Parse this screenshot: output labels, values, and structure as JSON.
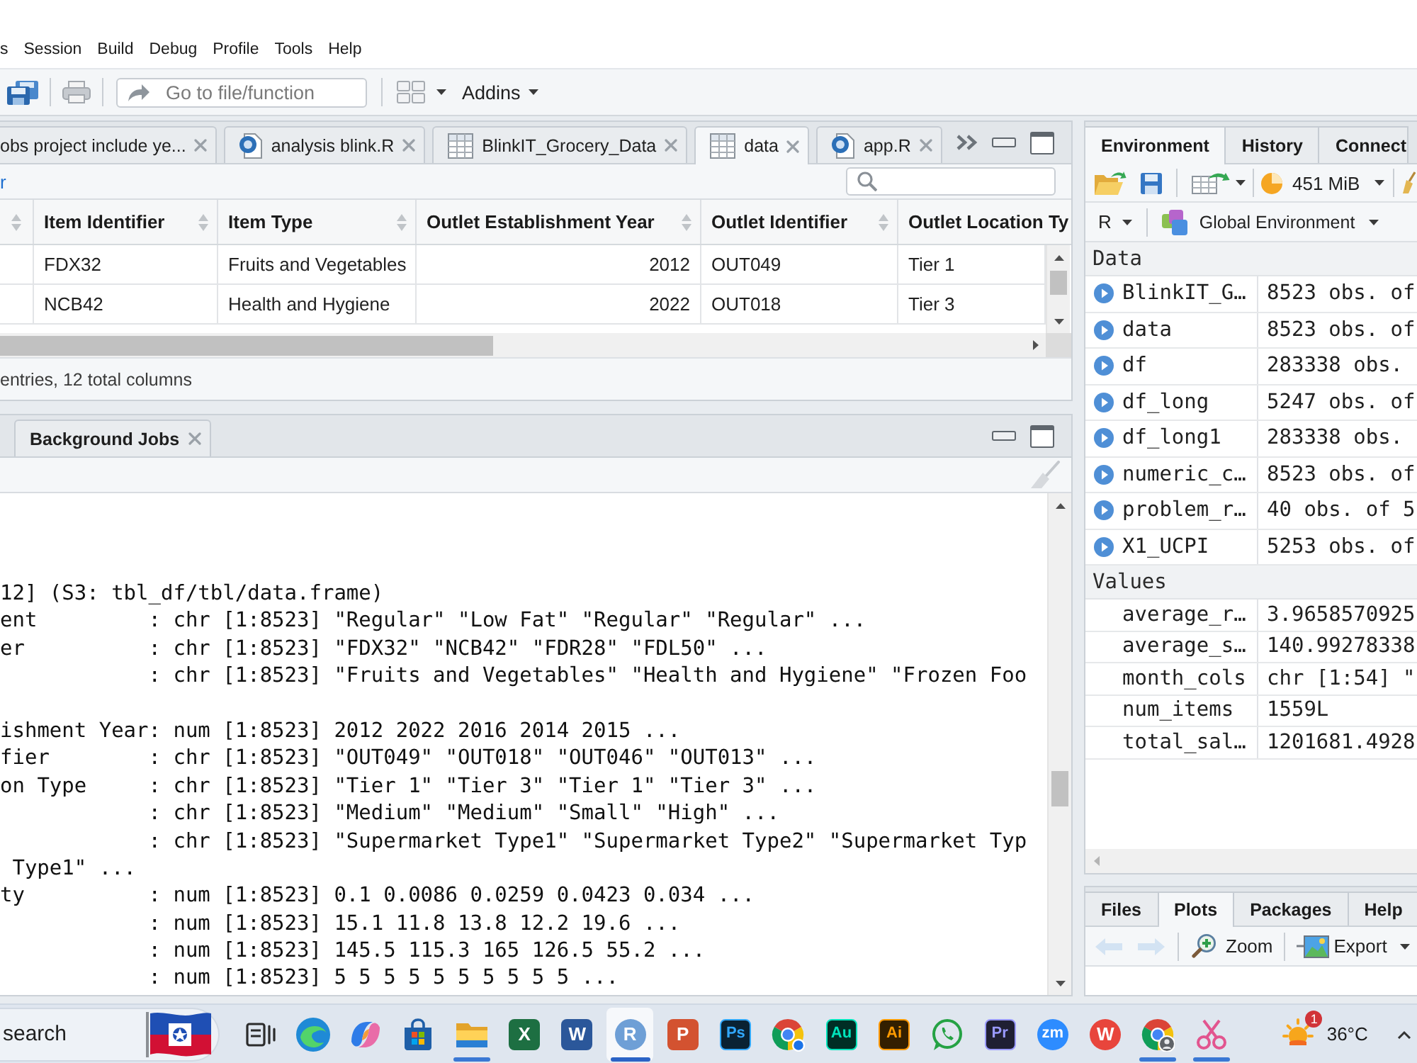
{
  "menu_bar": {
    "items": [
      "s",
      "Session",
      "Build",
      "Debug",
      "Profile",
      "Tools",
      "Help"
    ]
  },
  "toolbar": {
    "go_to_field": {
      "placeholder": "Go to file/function"
    },
    "addins_menu": "Addins"
  },
  "source_pane": {
    "tabs": [
      {
        "kind": "plain",
        "label": "obs project include ye...",
        "selected": false
      },
      {
        "kind": "script",
        "label": "analysis blink.R",
        "selected": false
      },
      {
        "kind": "viewer",
        "label": "BlinkIT_Grocery_Data",
        "selected": false
      },
      {
        "kind": "viewer",
        "label": "data",
        "selected": true
      },
      {
        "kind": "script",
        "label": "app.R",
        "selected": false
      }
    ],
    "link": "r",
    "table": {
      "columns": [
        {
          "sortable": true,
          "right_aligned": false
        },
        {
          "label": "Item Identifier",
          "right_aligned": false,
          "sortable": true
        },
        {
          "label": "Item Type",
          "right_aligned": false,
          "sortable": true
        },
        {
          "label": "Outlet Establishment Year",
          "right_aligned": true,
          "sortable": true
        },
        {
          "label": "Outlet Identifier",
          "right_aligned": false,
          "sortable": true
        },
        {
          "label": "Outlet Location Ty",
          "right_aligned": false,
          "sortable": false
        }
      ],
      "rows": [
        {
          "cells": [
            "",
            "FDX32",
            "Fruits and Vegetables",
            "2012",
            "OUT049",
            "Tier 1"
          ]
        },
        {
          "cells": [
            "",
            "NCB42",
            "Health and Hygiene",
            "2022",
            "OUT018",
            "Tier 3"
          ]
        }
      ]
    },
    "footer": "entries, 12 total columns"
  },
  "console_pane": {
    "tabs": [
      {
        "label": "Background Jobs",
        "selected": false
      }
    ],
    "lines": [
      {
        "kind": "plain",
        "text": "12] (S3: tbl_df/tbl/data.frame)"
      },
      {
        "kind": "field",
        "field": "ent",
        "value": ": chr [1:8523] \"Regular\" \"Low Fat\" \"Regular\" \"Regular\" ..."
      },
      {
        "kind": "field",
        "field": "er",
        "value": ": chr [1:8523] \"FDX32\" \"NCB42\" \"FDR28\" \"FDL50\" ..."
      },
      {
        "kind": "field",
        "value": ": chr [1:8523] \"Fruits and Vegetables\" \"Health and Hygiene\" \"Frozen Foo"
      },
      {
        "kind": "blank"
      },
      {
        "kind": "field",
        "field": "ishment Year",
        "value": ": num [1:8523] 2012 2022 2016 2014 2015 ..."
      },
      {
        "kind": "field",
        "field": "fier",
        "value": ": chr [1:8523] \"OUT049\" \"OUT018\" \"OUT046\" \"OUT013\" ..."
      },
      {
        "kind": "field",
        "field": "on Type",
        "value": ": chr [1:8523] \"Tier 1\" \"Tier 3\" \"Tier 1\" \"Tier 3\" ..."
      },
      {
        "kind": "field",
        "value": ": chr [1:8523] \"Medium\" \"Medium\" \"Small\" \"High\" ..."
      },
      {
        "kind": "field",
        "value": ": chr [1:8523] \"Supermarket Type1\" \"Supermarket Type2\" \"Supermarket Typ"
      },
      {
        "kind": "wrap",
        "text": "Type1\" ..."
      },
      {
        "kind": "field",
        "field": "ty",
        "value": ": num [1:8523] 0.1 0.0086 0.0259 0.0423 0.034 ..."
      },
      {
        "kind": "field",
        "value": ": num [1:8523] 15.1 11.8 13.8 12.2 19.6 ..."
      },
      {
        "kind": "field",
        "value": ": num [1:8523] 145.5 115.3 165 126.5 55.2 ..."
      },
      {
        "kind": "field",
        "value": ": num [1:8523] 5 5 5 5 5 5 5 5 5 5 ..."
      }
    ]
  },
  "environment_pane": {
    "tabs": [
      {
        "label": "Environment",
        "selected": true
      },
      {
        "label": "History",
        "selected": false
      },
      {
        "label": "Connect",
        "selected": false
      }
    ],
    "memory": "451 MiB",
    "language": "R",
    "scope": "Global Environment",
    "sections": [
      {
        "title": "Data",
        "items": [
          {
            "name": "BlinkIT_G…",
            "value": "8523 obs. of",
            "expandable": true
          },
          {
            "name": "data",
            "value": "8523 obs. of",
            "expandable": true
          },
          {
            "name": "df",
            "value": "283338 obs.",
            "expandable": true
          },
          {
            "name": "df_long",
            "value": "5247 obs. of",
            "expandable": true
          },
          {
            "name": "df_long1",
            "value": "283338 obs.",
            "expandable": true
          },
          {
            "name": "numeric_c…",
            "value": "8523 obs. of",
            "expandable": true
          },
          {
            "name": "problem_r…",
            "value": "40 obs. of 5",
            "expandable": true
          },
          {
            "name": "X1_UCPI",
            "value": "5253 obs. of",
            "expandable": true
          }
        ]
      },
      {
        "title": "Values",
        "items": [
          {
            "name": "average_r…",
            "value": "3.9658570925",
            "expandable": false
          },
          {
            "name": "average_s…",
            "value": "140.99278338",
            "expandable": false
          },
          {
            "name": "month_cols",
            "value": "chr [1:54] \"",
            "expandable": false
          },
          {
            "name": "num_items",
            "value": "1559L",
            "expandable": false
          },
          {
            "name": "total_sal…",
            "value": "1201681.4928",
            "expandable": false
          }
        ]
      }
    ]
  },
  "plots_pane": {
    "tabs": [
      {
        "label": "Files",
        "selected": false
      },
      {
        "label": "Plots",
        "selected": true
      },
      {
        "label": "Packages",
        "selected": false
      },
      {
        "label": "Help",
        "selected": false
      }
    ],
    "nav": [
      {
        "kind": "back",
        "disabled": true
      },
      {
        "kind": "forward",
        "disabled": true
      }
    ],
    "zoom": "Zoom",
    "export": "Export"
  },
  "taskbar": {
    "search": {
      "placeholder": "search"
    },
    "apps": [
      {
        "kind": "task_view",
        "selected": false,
        "running": false
      },
      {
        "kind": "swirl",
        "selected": false,
        "running": false
      },
      {
        "kind": "ribbon",
        "selected": false,
        "running": false
      },
      {
        "kind": "bag",
        "selected": false,
        "running": false
      },
      {
        "kind": "folder",
        "selected": false,
        "running": true
      },
      {
        "kind": "tile",
        "glyph": "X",
        "color": "#1d6f42",
        "selected": false,
        "running": false
      },
      {
        "kind": "tile",
        "glyph": "W",
        "color": "#2b579a",
        "selected": false,
        "running": false
      },
      {
        "kind": "circle",
        "glyph": "R",
        "color": "#6e9fd6",
        "selected": true,
        "running": true
      },
      {
        "kind": "tile",
        "glyph": "P",
        "color": "#d35230",
        "selected": false,
        "running": false
      },
      {
        "kind": "dark_tile",
        "glyph": "Ps",
        "color": "#31a8ff",
        "selected": false,
        "running": false
      },
      {
        "kind": "browser",
        "selected": false,
        "running": false
      },
      {
        "kind": "dark_tile",
        "glyph": "Au",
        "color": "#00e4bb",
        "selected": false,
        "running": false
      },
      {
        "kind": "dark_tile",
        "glyph": "Ai",
        "color": "#ff9a00",
        "selected": false,
        "running": false
      },
      {
        "kind": "chat",
        "selected": false,
        "running": false
      },
      {
        "kind": "dark_tile",
        "glyph": "Pr",
        "color": "#9999ff",
        "selected": false,
        "running": false
      },
      {
        "kind": "circle",
        "glyph": "zm",
        "color": "#2d8cff",
        "selected": false,
        "running": false
      },
      {
        "kind": "circle",
        "glyph": "W",
        "color": "#e8453c",
        "selected": false,
        "running": false
      },
      {
        "kind": "browser_avatar",
        "selected": false,
        "running": true
      },
      {
        "kind": "scissors",
        "selected": false,
        "running": true
      }
    ],
    "weather": {
      "badge": "1",
      "temperature": "36°C"
    }
  }
}
